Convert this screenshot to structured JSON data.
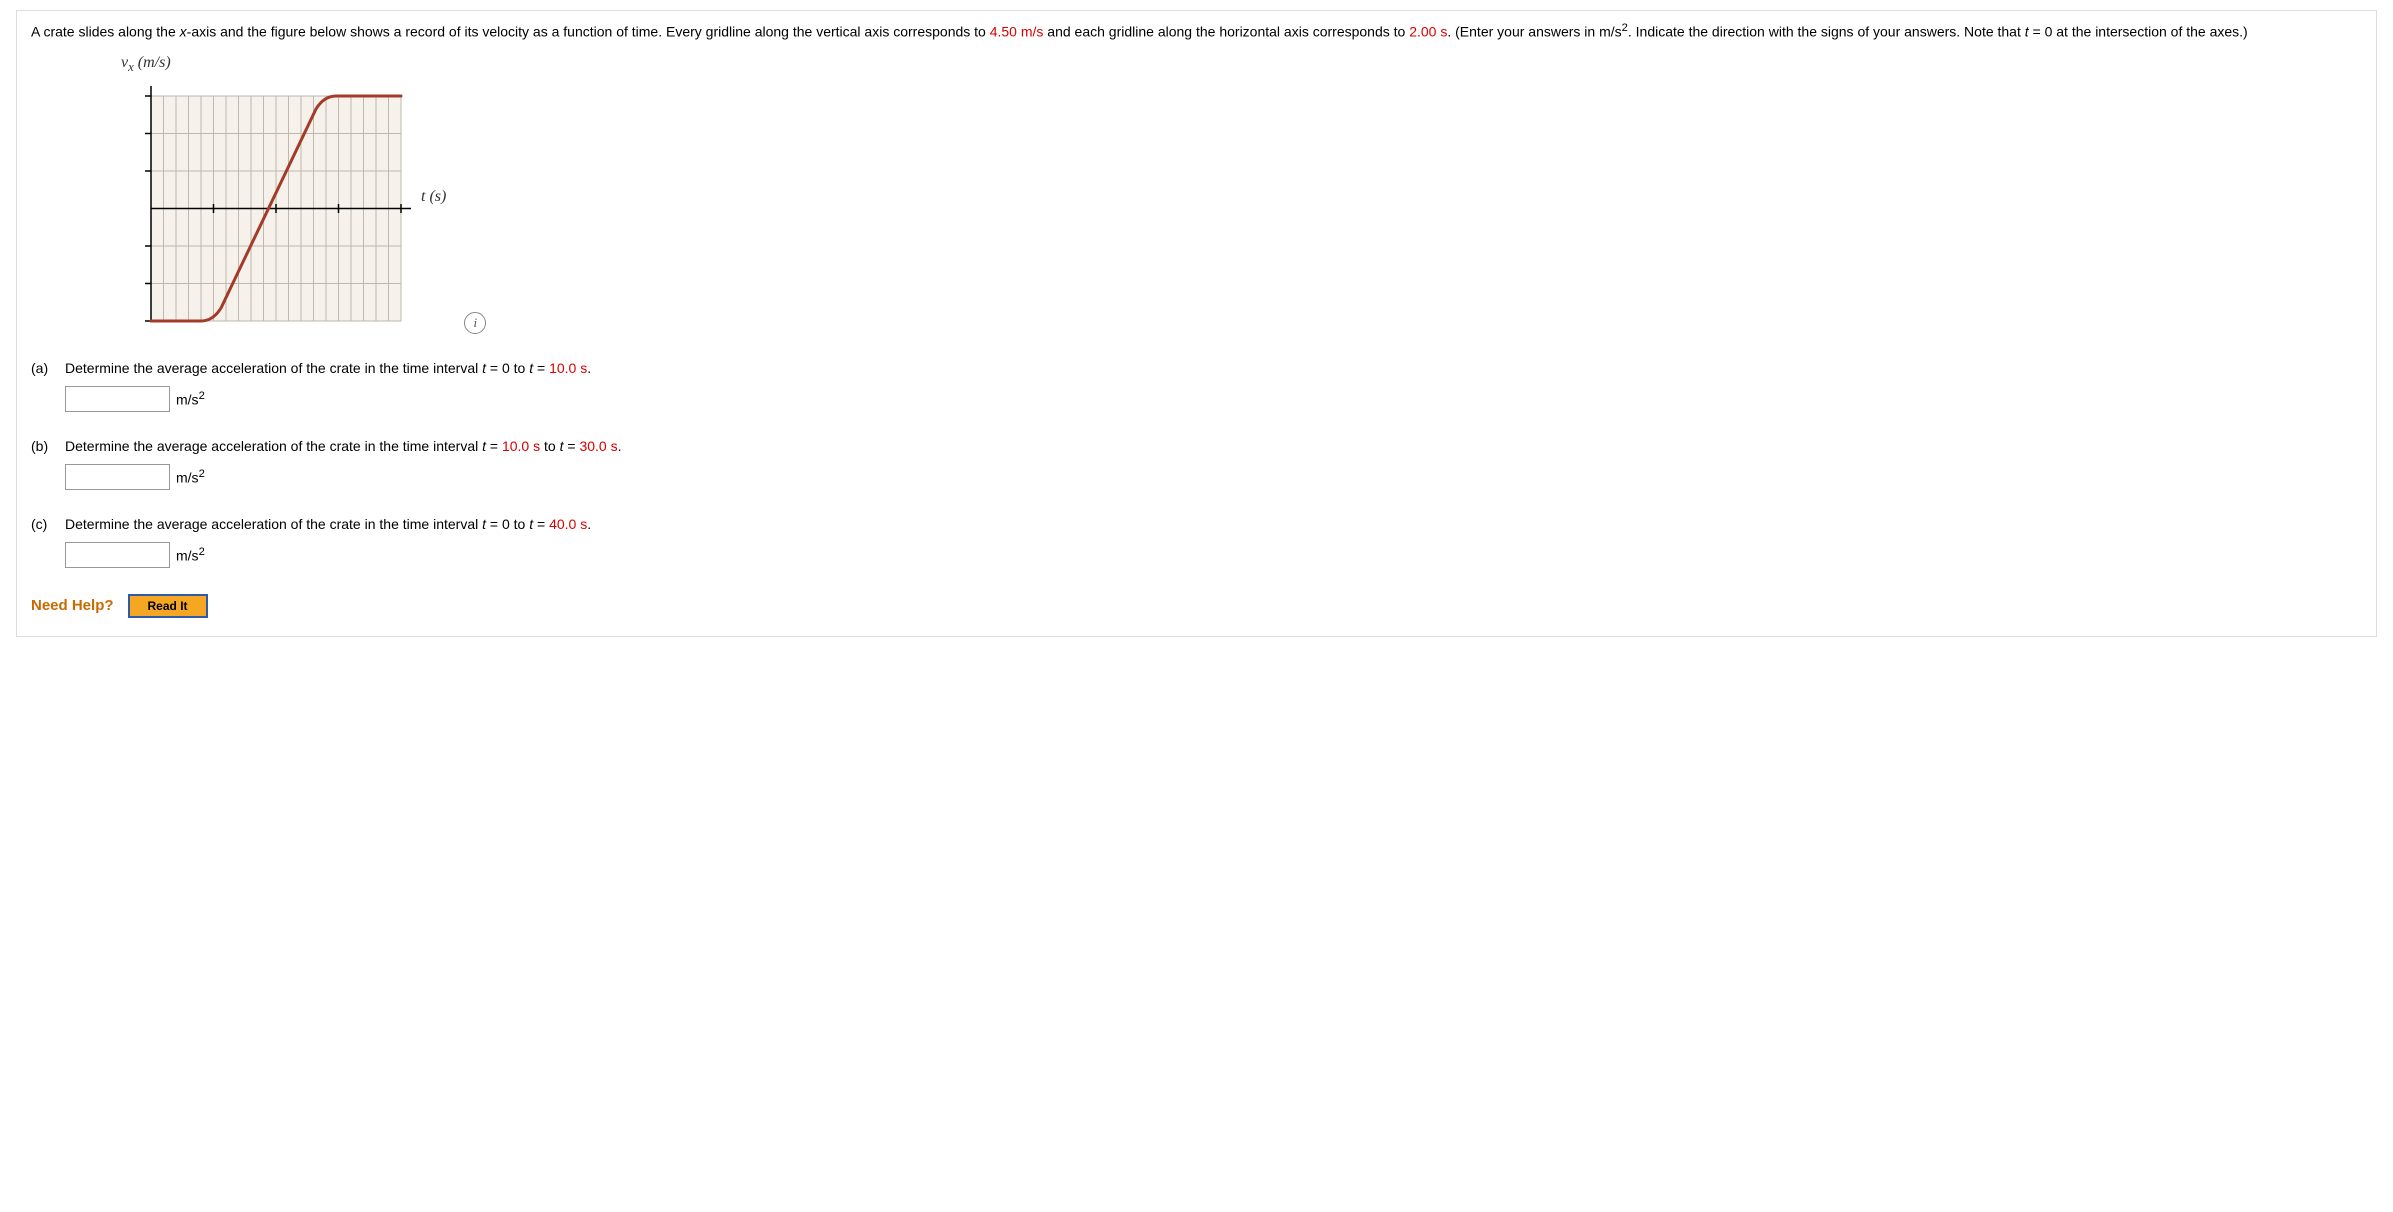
{
  "prompt": {
    "p1a": "A crate slides along the ",
    "p1xaxis": "x",
    "p1b": "-axis and the figure below shows a record of its velocity as a function of time. Every gridline along the vertical axis corresponds to ",
    "val1": "4.50 m/s",
    "p1c": " and each gridline along the horizontal axis corresponds to ",
    "val2": "2.00 s",
    "p1d": ". (Enter your answers in m/s",
    "p1e": ". Indicate the direction with the signs of your answers. Note that ",
    "tvar": "t",
    "p1f": " = 0 at the intersection of the axes.)"
  },
  "chart_data": {
    "type": "line",
    "xlabel": "t (s)",
    "ylabel": "v_x (m/s)",
    "x_step_s": 2.0,
    "y_step_mps": 4.5,
    "series": [
      {
        "name": "v_x",
        "points": [
          {
            "t_grid": 0,
            "v_grid": -3
          },
          {
            "t_grid": 4,
            "v_grid": -3
          },
          {
            "t_grid": 14,
            "v_grid": 3
          },
          {
            "t_grid": 20,
            "v_grid": 3
          }
        ]
      }
    ],
    "x_ticks_grid": [
      0,
      5,
      10,
      15,
      20
    ],
    "y_ticks_grid": [
      -3,
      -2,
      -1,
      0,
      1,
      2,
      3
    ],
    "grid": true
  },
  "info_icon": "i",
  "parts": {
    "a": {
      "label": "(a)",
      "q1": "Determine the average acceleration of the crate in the time interval ",
      "q2": " = 0 to ",
      "q3": " = ",
      "endval": "10.0 s",
      "q4": ".",
      "unit": "m/s"
    },
    "b": {
      "label": "(b)",
      "q1": "Determine the average acceleration of the crate in the time interval ",
      "q2": " = ",
      "startval": "10.0 s",
      "q2b": " to ",
      "q3": " = ",
      "endval": "30.0 s",
      "q4": ".",
      "unit": "m/s"
    },
    "c": {
      "label": "(c)",
      "q1": "Determine the average acceleration of the crate in the time interval ",
      "q2": " = 0 to ",
      "q3": " = ",
      "endval": "40.0 s",
      "q4": ".",
      "unit": "m/s"
    }
  },
  "need_help": "Need Help?",
  "read_it": "Read It",
  "sup2": "2"
}
